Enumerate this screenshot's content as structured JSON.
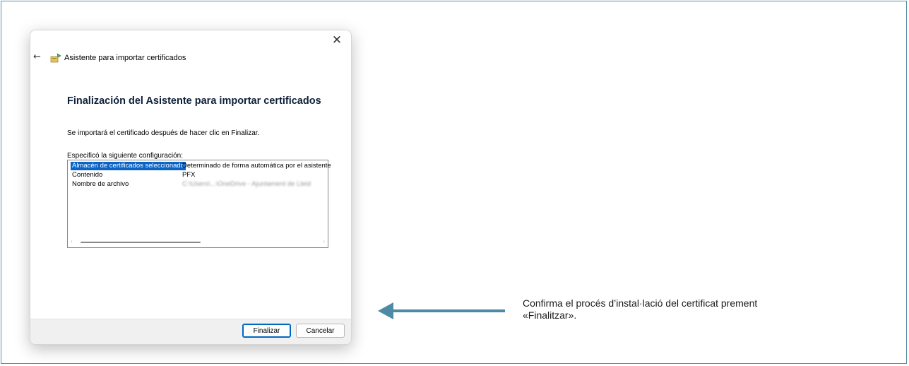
{
  "dialog": {
    "close_glyph": "✕",
    "back_glyph": "←",
    "title": "Asistente para importar certificados",
    "heading": "Finalización del Asistente para importar certificados",
    "info": "Se importará el certificado después de hacer clic en Finalizar.",
    "config_label": "Especificó la siguiente configuración:",
    "rows": [
      {
        "name": "Almacén de certificados seleccionado",
        "value": "Determinado de forma automática por el asistente"
      },
      {
        "name": "Contenido",
        "value": "PFX"
      },
      {
        "name": "Nombre de archivo",
        "value": "C:\\Users\\...\\OneDrive - Ajuntament de Lleid"
      }
    ],
    "finish_label": "Finalizar",
    "cancel_label": "Cancelar"
  },
  "caption": {
    "line1": "Confirma el procés d’instal·lació del certificat prement",
    "line2": "«Finalitzar»."
  },
  "colors": {
    "arrow": "#4d8aa3",
    "frame": "#5a8ea3",
    "selection": "#0a64c8"
  }
}
